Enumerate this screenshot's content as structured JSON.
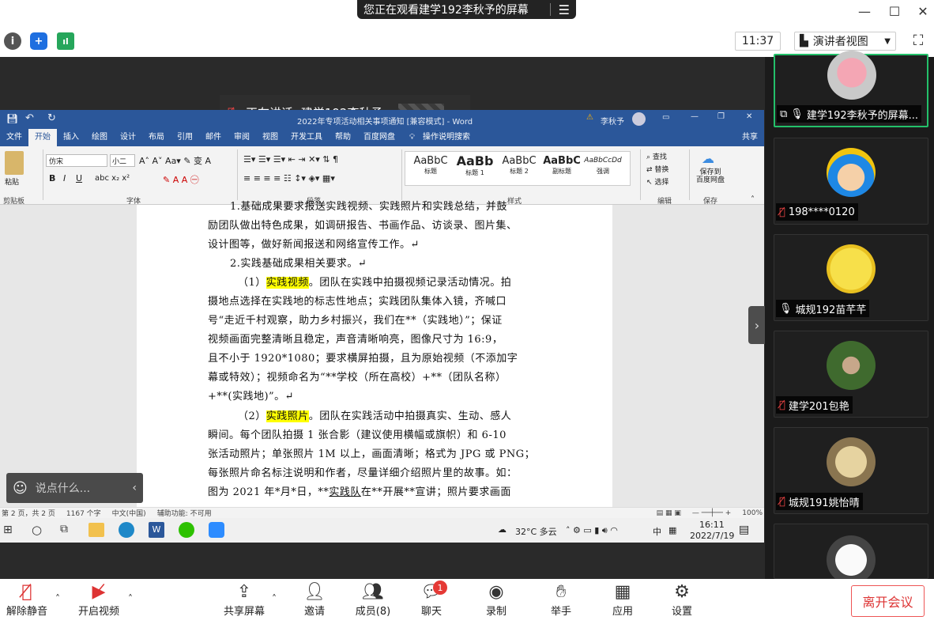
{
  "title_bar": {
    "share_notice": "您正在观看建学192李秋予的屏幕",
    "menu_icon": "hamburger-icon",
    "minimize": "—",
    "maximize": "☐",
    "close": "✕"
  },
  "top_bar": {
    "time": "11:37",
    "view_label": "演讲者视图",
    "talking_label": "正在讲话: 建学192李秋予;"
  },
  "word": {
    "title": "2022年专项活动相关事项通知 [兼容模式] - Word",
    "user": "李秋予",
    "tabs": [
      "文件",
      "开始",
      "插入",
      "绘图",
      "设计",
      "布局",
      "引用",
      "邮件",
      "审阅",
      "视图",
      "开发工具",
      "帮助",
      "百度网盘",
      "操作说明搜索"
    ],
    "share": "共享",
    "ribbon": {
      "paste": "粘贴",
      "clipboard": "剪贴板",
      "font_name": "仿宋",
      "font_size": "小二",
      "font_group": "字体",
      "paragraph_group": "段落",
      "styles_group": "样式",
      "styles": [
        {
          "sample": "AaBbC",
          "label": "标题"
        },
        {
          "sample": "AaBb",
          "label": "标题 1"
        },
        {
          "sample": "AaBbC",
          "label": "标题 2"
        },
        {
          "sample": "AaBbC",
          "label": "副标题"
        },
        {
          "sample": "AaBbCcDd",
          "label": "强调"
        }
      ],
      "find": "查找",
      "replace": "替换",
      "select": "选择",
      "edit_group": "编辑",
      "save_to_baidu": "保存到\n百度网盘",
      "save_group": "保存"
    },
    "doc_lines": [
      "1.基础成果要求报送实践视频、实践照片和实践总结，并鼓",
      "励团队做出特色成果，如调研报告、书画作品、访谈录、图片集、",
      "设计图等，做好新闻报送和网络宣传工作。↵",
      "2.实践基础成果相关要求。↵",
      "（1）",
      "实践视频",
      "。团队在实践中拍摄视频记录活动情况。拍",
      "摄地点选择在实践地的标志性地点；实践团队集体入镜，齐喊口",
      "号“走近千村观察，助力乡村振兴，我们在**（实践地）”；保证",
      "视频画面完整清晰且稳定，声音清晰响亮，图像尺寸为 16:9，",
      "且不小于 1920*1080；要求横屏拍摄，且为原始视频（不添加字",
      "幕或特效）；视频命名为“**学校（所在高校）+**（团队名称）",
      "+**(实践地)”。↵",
      "（2）",
      "实践照片",
      "。团队在实践活动中拍摄真实、生动、感人",
      "瞬间。每个团队拍摄 1 张合影（建议使用横幅或旗帜）和 6-10",
      "张活动照片；单张照片 1M 以上，画面清晰；格式为 JPG 或 PNG；",
      "每张照片命名标注说明和作者，尽量详细介绍照片里的故事。如：",
      "图为 2021 年*月*日，**",
      "实践队",
      "在**开展**宣讲；照片要求画面"
    ],
    "status": {
      "page": "第 2 页，共 2 页",
      "words": "1167 个字",
      "lang": "中文(中国)",
      "access": "辅助功能: 不可用",
      "zoom": "100%"
    }
  },
  "taskbar": {
    "weather": "32°C 多云",
    "ime": "中",
    "time": "16:11",
    "date": "2022/7/19"
  },
  "chat_input": {
    "placeholder": "说点什么..."
  },
  "participants": [
    {
      "name": "建学192李秋予的屏幕...",
      "muted": false,
      "sharing": true
    },
    {
      "name": "198****0120",
      "muted": true
    },
    {
      "name": "城规192苗芊芊",
      "muted": false
    },
    {
      "name": "建学201包艳",
      "muted": true
    },
    {
      "name": "城规191姚怡晴",
      "muted": true
    },
    {
      "name": "",
      "muted": false
    }
  ],
  "bottom_bar": {
    "unmute": "解除静音",
    "start_video": "开启视频",
    "share_screen": "共享屏幕",
    "invite": "邀请",
    "members": "成员(8)",
    "chat": "聊天",
    "chat_badge": "1",
    "record": "录制",
    "raise_hand": "举手",
    "apps": "应用",
    "settings": "设置",
    "leave": "离开会议"
  },
  "colors": {
    "word_blue": "#2b579a",
    "highlight": "#ffff00",
    "active_speaker": "#23c06a",
    "danger": "#d33333"
  }
}
